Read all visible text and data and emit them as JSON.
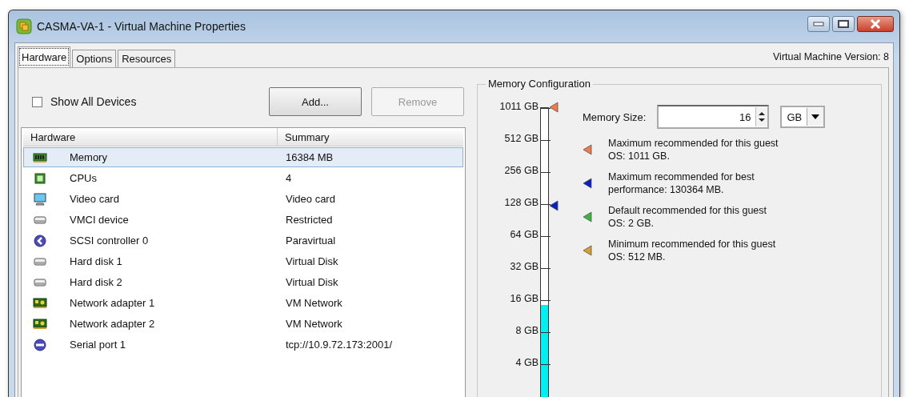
{
  "window": {
    "title": "CASMA-VA-1 - Virtual Machine Properties"
  },
  "tabs": [
    {
      "label": "Hardware",
      "selected": true
    },
    {
      "label": "Options",
      "selected": false
    },
    {
      "label": "Resources",
      "selected": false
    }
  ],
  "version": "Virtual Machine Version: 8",
  "show_all_devices": {
    "label": "Show All Devices",
    "checked": false
  },
  "buttons": [
    {
      "label": "Add...",
      "disabled": false
    },
    {
      "label": "Remove",
      "disabled": true
    }
  ],
  "table": {
    "columns": [
      "Hardware",
      "Summary"
    ],
    "rows": [
      {
        "kind": "memory",
        "hardware": "Memory",
        "summary": "16384 MB",
        "selected": true
      },
      {
        "kind": "cpu",
        "hardware": "CPUs",
        "summary": "4",
        "selected": false
      },
      {
        "kind": "video",
        "hardware": "Video card",
        "summary": "Video card",
        "selected": false
      },
      {
        "kind": "disk",
        "hardware": "VMCI device",
        "summary": "Restricted",
        "selected": false
      },
      {
        "kind": "scsi",
        "hardware": "SCSI controller 0",
        "summary": "Paravirtual",
        "selected": false
      },
      {
        "kind": "disk",
        "hardware": "Hard disk 1",
        "summary": "Virtual Disk",
        "selected": false
      },
      {
        "kind": "disk",
        "hardware": "Hard disk 2",
        "summary": "Virtual Disk",
        "selected": false
      },
      {
        "kind": "network",
        "hardware": "Network adapter 1",
        "summary": "VM Network",
        "selected": false
      },
      {
        "kind": "network",
        "hardware": "Network adapter 2",
        "summary": "VM Network",
        "selected": false
      },
      {
        "kind": "serial",
        "hardware": "Serial port 1",
        "summary": "tcp://10.9.72.173:2001/",
        "selected": false
      }
    ]
  },
  "memory_configuration": {
    "title": "Memory Configuration",
    "scale": {
      "level": 0.37,
      "ticks": [
        {
          "label": "1011 GB",
          "color": "#f07a4a"
        },
        {
          "label": "512 GB"
        },
        {
          "label": "256 GB"
        },
        {
          "label": "128 GB",
          "color": "#0a1ec8"
        },
        {
          "label": "64 GB"
        },
        {
          "label": "32 GB"
        },
        {
          "label": "16 GB"
        },
        {
          "label": "8 GB"
        },
        {
          "label": "4 GB"
        }
      ]
    },
    "memory_size": {
      "label": "Memory Size:",
      "value": "16",
      "unit": "GB"
    },
    "legend": [
      {
        "text": "Maximum recommended for this guest OS: 1011 GB.",
        "color": "#f07a4a"
      },
      {
        "text": "Maximum recommended for best performance: 130364 MB.",
        "color": "#0a1ec8"
      },
      {
        "text": "Default recommended for this guest OS: 2 GB.",
        "color": "#3cb43c"
      },
      {
        "text": "Minimum recommended for this guest OS: 512 MB.",
        "color": "#d4a030"
      }
    ]
  }
}
